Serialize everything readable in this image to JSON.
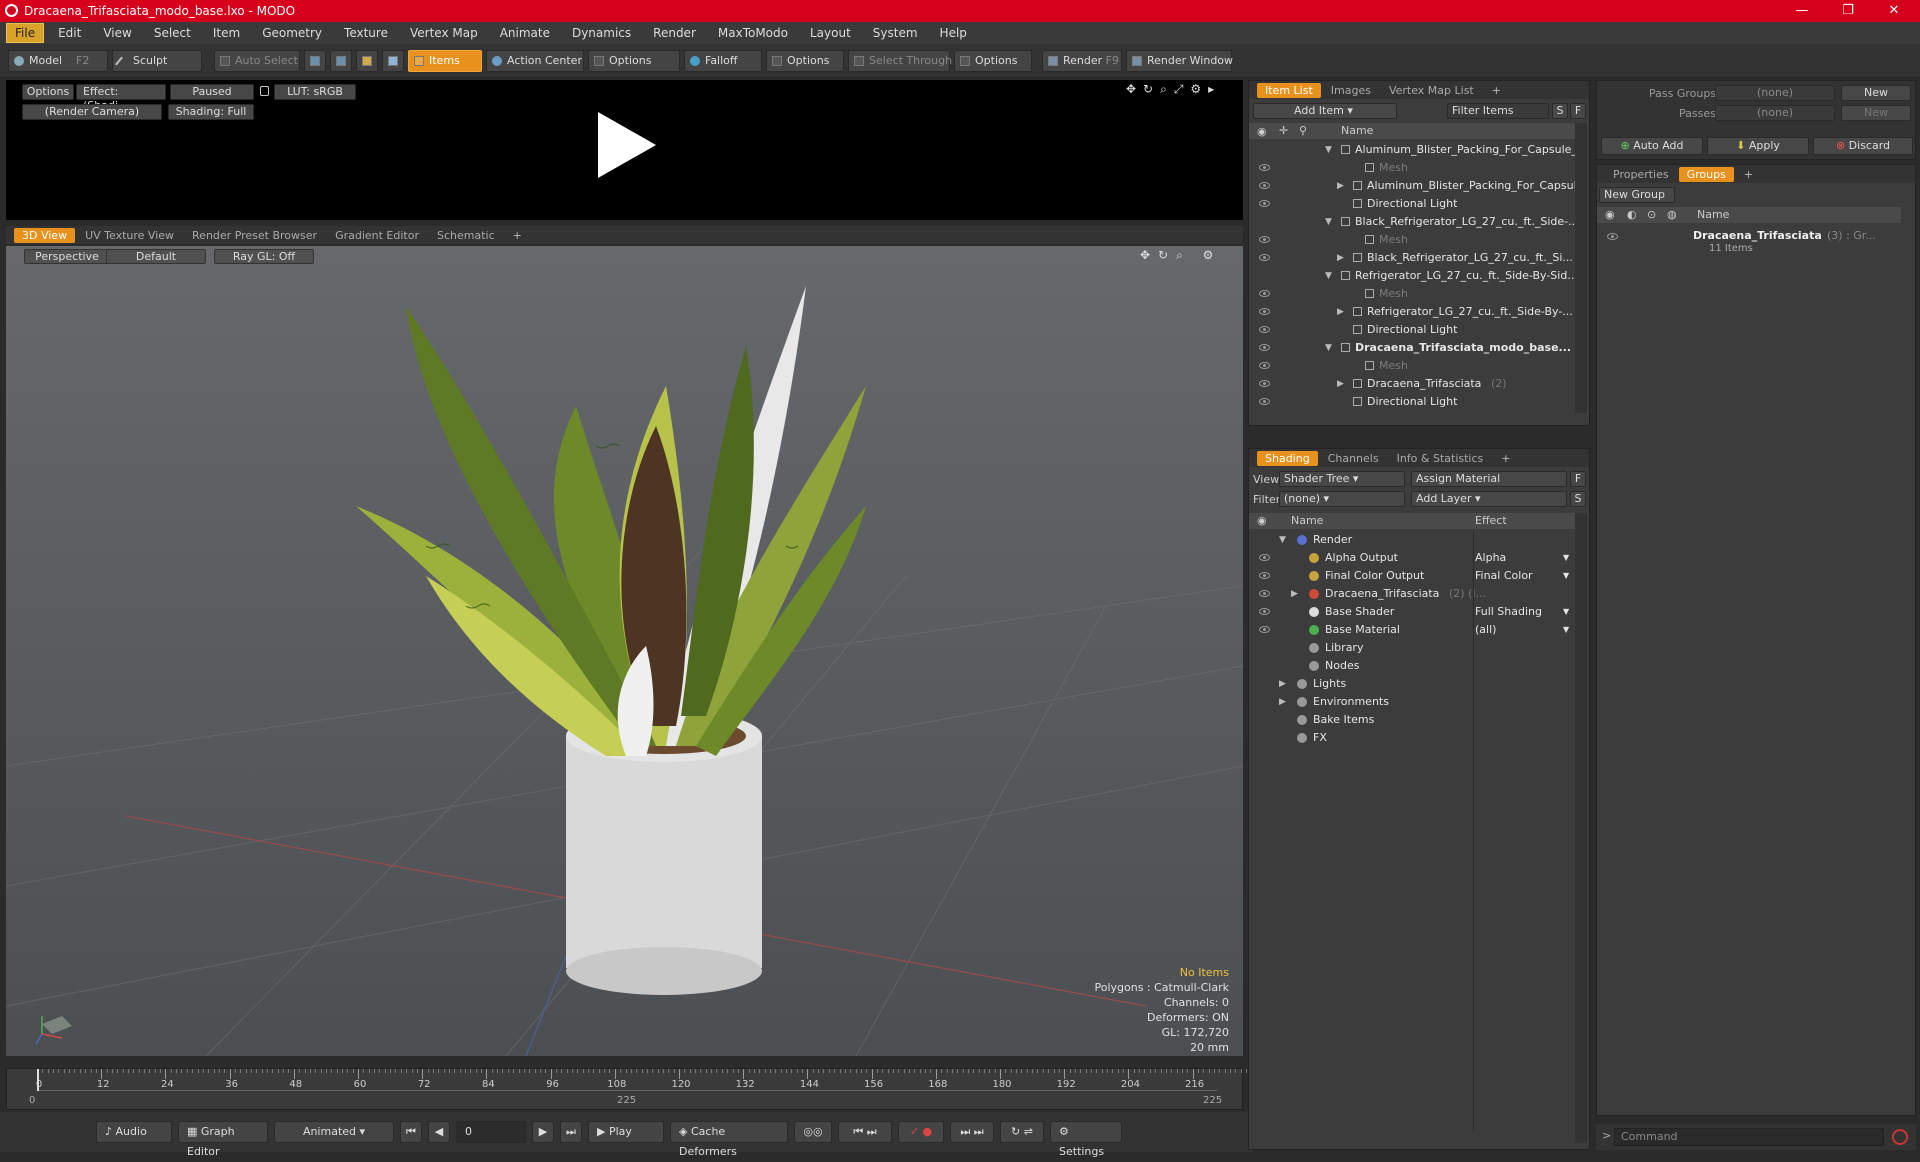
{
  "window": {
    "title": "Dracaena_Trifasciata_modo_base.lxo - MODO"
  },
  "menu": [
    "File",
    "Edit",
    "View",
    "Select",
    "Item",
    "Geometry",
    "Texture",
    "Vertex Map",
    "Animate",
    "Dynamics",
    "Render",
    "MaxToModo",
    "Layout",
    "System",
    "Help"
  ],
  "toolbar": {
    "model": "Model",
    "model_key": "F2",
    "sculpt": "Sculpt",
    "auto_select": "Auto Select",
    "items": "Items",
    "action_center": "Action Center",
    "options1": "Options",
    "falloff": "Falloff",
    "options2": "Options",
    "select_through": "Select Through",
    "options3": "Options",
    "render": "Render",
    "render_key": "F9",
    "render_window": "Render Window"
  },
  "preview": {
    "options": "Options",
    "effect": "Effect: (Shadi...",
    "paused": "Paused",
    "lut": "LUT: sRGB",
    "camera": "(Render Camera)",
    "shading": "Shading: Full"
  },
  "viewport_tabs": [
    "3D View",
    "UV Texture View",
    "Render Preset Browser",
    "Gradient Editor",
    "Schematic"
  ],
  "viewport": {
    "perspective": "Perspective",
    "default": "Default",
    "raygl": "Ray GL: Off"
  },
  "stats": {
    "no_items": "No Items",
    "polygons": "Polygons : Catmull-Clark",
    "channels": "Channels: 0",
    "deformers": "Deformers: ON",
    "gl": "GL: 172,720",
    "unit": "20 mm"
  },
  "timeline": {
    "ticks": [
      "0",
      "12",
      "24",
      "36",
      "48",
      "60",
      "72",
      "84",
      "96",
      "108",
      "120",
      "132",
      "144",
      "156",
      "168",
      "180",
      "192",
      "204",
      "216"
    ],
    "start": "0",
    "mid": "225",
    "end": "225"
  },
  "bottombar": {
    "audio": "Audio",
    "graph_editor": "Graph Editor",
    "animated": "Animated",
    "frame": "0",
    "play": "Play",
    "cache": "Cache Deformers",
    "settings": "Settings"
  },
  "itemlist": {
    "tabs": [
      "Item List",
      "Images",
      "Vertex Map List"
    ],
    "add_item": "Add Item",
    "filter": "Filter Items",
    "s": "S",
    "f": "F",
    "name_col": "Name",
    "rows": [
      {
        "label": "Aluminum_Blister_Packing_For_Capsule_...",
        "indent": 0,
        "arrow": "▼",
        "dim": false,
        "bold": false,
        "eye": false
      },
      {
        "label": "Mesh",
        "indent": 2,
        "arrow": "",
        "dim": true,
        "bold": false,
        "eye": true
      },
      {
        "label": "Aluminum_Blister_Packing_For_Capsul...",
        "indent": 1,
        "arrow": "▶",
        "dim": false,
        "bold": false,
        "eye": true
      },
      {
        "label": "Directional Light",
        "indent": 1,
        "arrow": "",
        "dim": false,
        "bold": false,
        "eye": true
      },
      {
        "label": "Black_Refrigerator_LG_27_cu._ft._Side-...",
        "indent": 0,
        "arrow": "▼",
        "dim": false,
        "bold": false,
        "eye": false
      },
      {
        "label": "Mesh",
        "indent": 2,
        "arrow": "",
        "dim": true,
        "bold": false,
        "eye": true
      },
      {
        "label": "Black_Refrigerator_LG_27_cu._ft._Si...",
        "indent": 1,
        "arrow": "▶",
        "dim": false,
        "bold": false,
        "eye": true
      },
      {
        "label": "Refrigerator_LG_27_cu._ft._Side-By-Sid...",
        "indent": 0,
        "arrow": "▼",
        "dim": false,
        "bold": false,
        "eye": false
      },
      {
        "label": "Mesh",
        "indent": 2,
        "arrow": "",
        "dim": true,
        "bold": false,
        "eye": true
      },
      {
        "label": "Refrigerator_LG_27_cu._ft._Side-By-...",
        "indent": 1,
        "arrow": "▶",
        "dim": false,
        "bold": false,
        "eye": true
      },
      {
        "label": "Directional Light",
        "indent": 1,
        "arrow": "",
        "dim": false,
        "bold": false,
        "eye": true
      },
      {
        "label": "Dracaena_Trifasciata_modo_base...",
        "indent": 0,
        "arrow": "▼",
        "dim": false,
        "bold": true,
        "eye": true
      },
      {
        "label": "Mesh",
        "indent": 2,
        "arrow": "",
        "dim": true,
        "bold": false,
        "eye": true
      },
      {
        "label": "Dracaena_Trifasciata",
        "count": "(2)",
        "indent": 1,
        "arrow": "▶",
        "dim": false,
        "bold": false,
        "eye": true
      },
      {
        "label": "Directional Light",
        "indent": 1,
        "arrow": "",
        "dim": false,
        "bold": false,
        "eye": true
      }
    ]
  },
  "shading": {
    "tabs": [
      "Shading",
      "Channels",
      "Info & Statistics"
    ],
    "view_label": "View",
    "view_value": "Shader Tree",
    "assign": "Assign Material",
    "f": "F",
    "filter_label": "Filter",
    "filter_value": "(none)",
    "add_layer": "Add Layer",
    "s": "S",
    "name_col": "Name",
    "effect_col": "Effect",
    "rows": [
      {
        "label": "Render",
        "effect": "",
        "indent": 0,
        "arrow": "▼",
        "eye": false
      },
      {
        "label": "Alpha Output",
        "effect": "Alpha",
        "indent": 1,
        "arrow": "",
        "eye": true
      },
      {
        "label": "Final Color Output",
        "effect": "Final Color",
        "indent": 1,
        "arrow": "",
        "eye": true
      },
      {
        "label": "Dracaena_Trifasciata",
        "extra": "(2) (I...",
        "effect": "",
        "indent": 1,
        "arrow": "▶",
        "eye": true
      },
      {
        "label": "Base Shader",
        "effect": "Full Shading",
        "indent": 1,
        "arrow": "",
        "eye": true
      },
      {
        "label": "Base Material",
        "effect": "(all)",
        "indent": 1,
        "arrow": "",
        "eye": true
      },
      {
        "label": "Library",
        "effect": "",
        "indent": 1,
        "arrow": "",
        "eye": false
      },
      {
        "label": "Nodes",
        "effect": "",
        "indent": 1,
        "arrow": "",
        "eye": false
      },
      {
        "label": "Lights",
        "effect": "",
        "indent": 0,
        "arrow": "▶",
        "eye": false
      },
      {
        "label": "Environments",
        "effect": "",
        "indent": 0,
        "arrow": "▶",
        "eye": false
      },
      {
        "label": "Bake Items",
        "effect": "",
        "indent": 0,
        "arrow": "",
        "eye": false
      },
      {
        "label": "FX",
        "effect": "",
        "indent": 0,
        "arrow": "",
        "eye": false
      }
    ]
  },
  "passes": {
    "pass_groups": "Pass Groups",
    "passes": "Passes",
    "none": "(none)",
    "new": "New",
    "auto_add": "Auto Add",
    "apply": "Apply",
    "discard": "Discard"
  },
  "groups": {
    "tabs": [
      "Properties",
      "Groups"
    ],
    "new_group": "New Group",
    "name_col": "Name",
    "group_name": "Dracaena_Trifasciata",
    "group_extra": "(3) : Gr...",
    "group_sub": "11 Items"
  },
  "command": {
    "placeholder": "Command"
  },
  "colors": {
    "title_red": "#d6001c",
    "accent": "#e8921d"
  }
}
